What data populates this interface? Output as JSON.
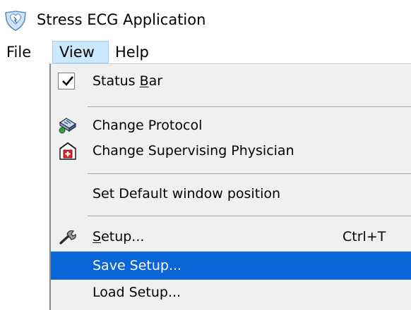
{
  "window": {
    "title": "Stress ECG Application",
    "icon": "heart-shield-icon"
  },
  "menubar": {
    "items": [
      {
        "label": "File"
      },
      {
        "label": "View",
        "state": "open"
      },
      {
        "label": "Help"
      }
    ]
  },
  "view_menu": {
    "status_bar": {
      "label": "Status ",
      "mnemonic": "B",
      "label_rest": "ar",
      "checked": true,
      "icon": "checkmark-icon"
    },
    "change_protocol": {
      "label": "Change Protocol",
      "icon": "protocol-icon"
    },
    "change_supervising_physician": {
      "label": "Change Supervising Physician",
      "icon": "physician-icon"
    },
    "set_default_window_position": {
      "label": "Set Default window position"
    },
    "setup": {
      "mnemonic": "S",
      "label_rest": "etup...",
      "shortcut": "Ctrl+T",
      "icon": "wrench-icon"
    },
    "save_setup": {
      "label": "Save Setup...",
      "selected": true
    },
    "load_setup": {
      "label": "Load Setup..."
    }
  },
  "colors": {
    "selected_item": "#0a66d6",
    "open_menu_highlight": "#cce8ff",
    "menu_background": "#f0f0f0"
  }
}
